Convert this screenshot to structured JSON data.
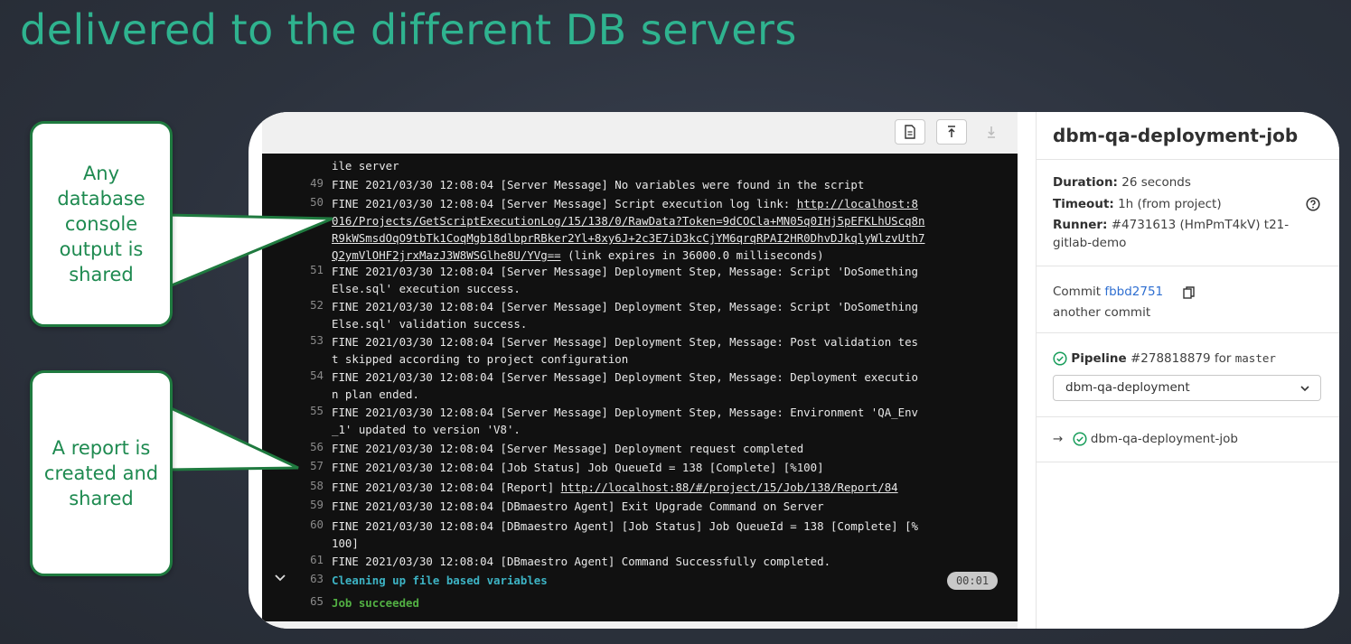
{
  "slide_title": "delivered to the different DB servers",
  "callouts": [
    {
      "text": "Any database console output is shared"
    },
    {
      "text": "A report is created and shared"
    }
  ],
  "toolbar": {
    "raw_icon": "file-text-icon",
    "scroll_top_icon": "scroll-top-icon",
    "scroll_bottom_icon": "scroll-bottom-icon"
  },
  "log": {
    "partial_first": "ile server",
    "lines": [
      {
        "n": "49",
        "parts": [
          "FINE 2021/03/30 12:08:04 [Server Message] No variables were found in the script"
        ]
      },
      {
        "n": "50",
        "parts": [
          "FINE 2021/03/30 12:08:04 [Server Message] Script execution log link: "
        ],
        "link": [
          "http://localhost:8",
          "016/Projects/GetScriptExecutionLog/15/138/0/RawData?Token=9dCOCla+MN05q0IHj5pEFKLhUScq8n",
          "R9kWSmsdOqO9tbTk1CoqMgb18dlbprRBker2Yl+8xy6J+2c3E7iD3kcCjYM6qrqRPAI2HR0DhvDJkqlyWlzvUth7",
          "Q2ymVlOHF2jrxMazJ3W8WSGlhe8U/YVg=="
        ],
        "after": " (link expires in 36000.0 milliseconds)"
      },
      {
        "n": "51",
        "parts": [
          "FINE 2021/03/30 12:08:04 [Server Message] Deployment Step, Message: Script 'DoSomething",
          "Else.sql' execution success."
        ]
      },
      {
        "n": "52",
        "parts": [
          "FINE 2021/03/30 12:08:04 [Server Message] Deployment Step, Message: Script 'DoSomething",
          "Else.sql' validation success."
        ]
      },
      {
        "n": "53",
        "parts": [
          "FINE 2021/03/30 12:08:04 [Server Message] Deployment Step, Message: Post validation tes",
          "t skipped according to project configuration"
        ]
      },
      {
        "n": "54",
        "parts": [
          "FINE 2021/03/30 12:08:04 [Server Message] Deployment Step, Message: Deployment executio",
          "n plan ended."
        ]
      },
      {
        "n": "55",
        "parts": [
          "FINE 2021/03/30 12:08:04 [Server Message] Deployment Step, Message: Environment 'QA_Env",
          "_1' updated to version 'V8'."
        ]
      },
      {
        "n": "56",
        "parts": [
          "FINE 2021/03/30 12:08:04 [Server Message] Deployment request completed"
        ]
      },
      {
        "n": "57",
        "parts": [
          "FINE 2021/03/30 12:08:04 [Job Status] Job QueueId = 138 [Complete] [%100]"
        ]
      },
      {
        "n": "58",
        "parts": [
          "FINE 2021/03/30 12:08:04 [Report] "
        ],
        "link": [
          "http://localhost:88/#/project/15/Job/138/Report/84"
        ]
      },
      {
        "n": "59",
        "parts": [
          "FINE 2021/03/30 12:08:04 [DBmaestro Agent] Exit Upgrade Command on Server"
        ]
      },
      {
        "n": "60",
        "parts": [
          "FINE 2021/03/30 12:08:04 [DBmaestro Agent] [Job Status] Job QueueId = 138 [Complete] [%",
          "100]"
        ]
      },
      {
        "n": "61",
        "parts": [
          "FINE 2021/03/30 12:08:04 [DBmaestro Agent] Command Successfully completed."
        ]
      }
    ],
    "section_line_num": "63",
    "section_text": "Cleaning up file based variables",
    "section_time": "00:01",
    "final_line_num": "65",
    "final_text": "Job succeeded"
  },
  "sidebar": {
    "job_title": "dbm-qa-deployment-job",
    "duration_label": "Duration:",
    "duration_value": " 26 seconds",
    "timeout_label": "Timeout:",
    "timeout_value": " 1h (from project)",
    "runner_label": "Runner:",
    "runner_value_1": " #4731613 (HmPmT4kV) t21-",
    "runner_value_2": "gitlab-demo",
    "commit_label": "Commit",
    "commit_sha": "fbbd2751",
    "commit_message": "another commit",
    "pipeline_label": "Pipeline",
    "pipeline_id": "#278818879",
    "pipeline_for": "for",
    "pipeline_branch": "master",
    "stage_select": "dbm-qa-deployment",
    "current_job_arrow": "→",
    "current_job": "dbm-qa-deployment-job"
  },
  "colors": {
    "accent": "#2fb38f",
    "callout_border": "#1f7a3f",
    "link": "#2f6fd1",
    "success": "#52b043"
  }
}
